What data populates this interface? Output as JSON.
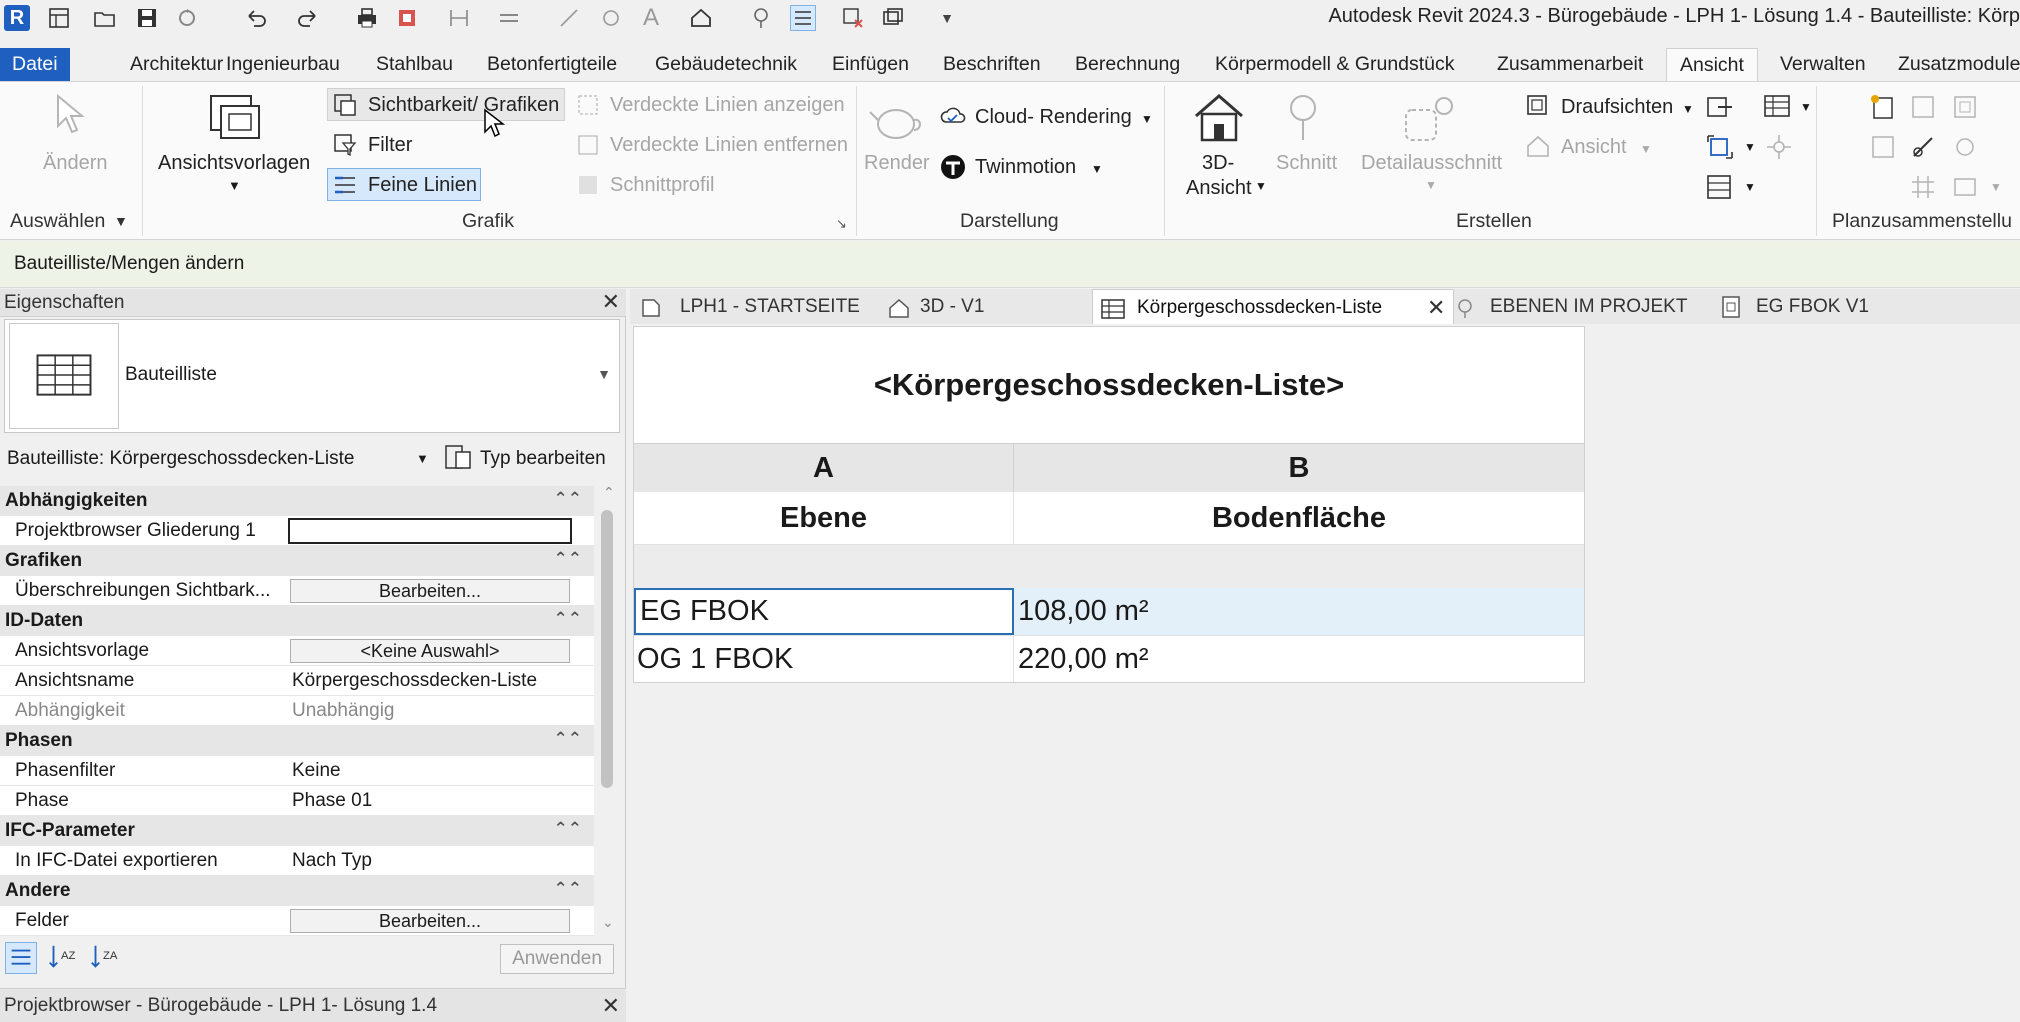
{
  "app": {
    "logo": "R",
    "title": "Autodesk Revit 2024.3 - Bürogebäude - LPH 1- Lösung 1.4 - Bauteilliste: Körp"
  },
  "menu": {
    "tabs": [
      "Datei",
      "Architektur",
      "Ingenieurbau",
      "Stahlbau",
      "Betonfertigteile",
      "Gebäudetechnik",
      "Einfügen",
      "Beschriften",
      "Berechnung",
      "Körpermodell & Grundstück",
      "Zusammenarbeit",
      "Ansicht",
      "Verwalten",
      "Zusatzmodule"
    ],
    "active": "Ansicht"
  },
  "ribbon": {
    "aendern": "Ändern",
    "auswaehlen": "Auswählen",
    "ansichtsvorlagen": "Ansichtsvorlagen",
    "sichtbarkeit": "Sichtbarkeit/ Grafiken",
    "filter": "Filter",
    "feine_linien": "Feine Linien",
    "verdeckte_anzeigen": "Verdeckte Linien anzeigen",
    "verdeckte_entfernen": "Verdeckte Linien entfernen",
    "schnittprofil": "Schnittprofil",
    "grafik": "Grafik",
    "render": "Render",
    "cloud_rendering": "Cloud- Rendering",
    "twinmotion": "Twinmotion",
    "darstellung": "Darstellung",
    "ansicht_3d_1": "3D-",
    "ansicht_3d_2": "Ansicht",
    "schnitt": "Schnitt",
    "detailausschnitt": "Detailausschnitt",
    "draufsichten": "Draufsichten",
    "ansicht": "Ansicht",
    "erstellen": "Erstellen",
    "planzusammenstellung": "Planzusammenstellu"
  },
  "mode_bar": "Bauteilliste/Mengen ändern",
  "properties": {
    "title": "Eigenschaften",
    "type_name": "Bauteilliste",
    "selector": "Bauteilliste: Körpergeschossdecken-Liste",
    "edit_type": "Typ bearbeiten",
    "groups": {
      "abh": "Abhängigkeiten",
      "graf": "Grafiken",
      "id": "ID-Daten",
      "phasen": "Phasen",
      "ifc": "IFC-Parameter",
      "andere": "Andere"
    },
    "rows": {
      "pb_key": "Projektbrowser Gliederung 1",
      "pb_val": "",
      "ues_key": "Überschreibungen Sichtbark...",
      "ues_btn": "Bearbeiten...",
      "av_key": "Ansichtsvorlage",
      "av_btn": "<Keine Auswahl>",
      "an_key": "Ansichtsname",
      "an_val": "Körpergeschossdecken-Liste",
      "ab_key": "Abhängigkeit",
      "ab_val": "Unabhängig",
      "pf_key": "Phasenfilter",
      "pf_val": "Keine",
      "ph_key": "Phase",
      "ph_val": "Phase 01",
      "ifc_key": "In IFC-Datei exportieren",
      "ifc_val": "Nach Typ",
      "fe_key": "Felder",
      "fe_btn": "Bearbeiten..."
    },
    "apply": "Anwenden"
  },
  "project_browser": "Projektbrowser - Bürogebäude - LPH 1- Lösung 1.4",
  "doc_tabs": {
    "t1": "LPH1 - STARTSEITE",
    "t2": "3D - V1",
    "t3": "Körpergeschossdecken-Liste",
    "t4": "EBENEN IM PROJEKT",
    "t5": "EG FBOK V1"
  },
  "schedule": {
    "title": "<Körpergeschossdecken-Liste>",
    "col_a": "A",
    "col_b": "B",
    "head_a": "Ebene",
    "head_b": "Bodenfläche",
    "rows": [
      {
        "ebene": "EG FBOK",
        "flaeche": "108,00 m²"
      },
      {
        "ebene": "OG 1 FBOK",
        "flaeche": "220,00 m²"
      }
    ]
  }
}
